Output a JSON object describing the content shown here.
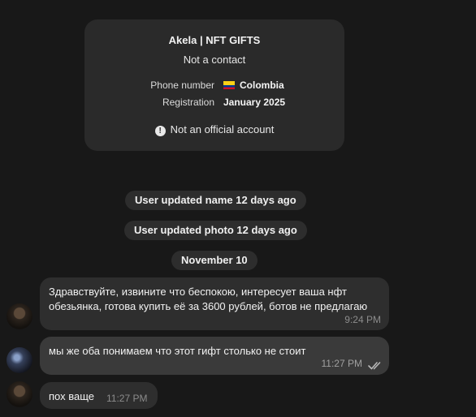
{
  "info_card": {
    "name": "Akela | NFT GIFTS",
    "subtitle": "Not a contact",
    "phone_label": "Phone number",
    "phone_value": "Colombia",
    "registration_label": "Registration",
    "registration_value": "January 2025",
    "official_notice": "Not an official account",
    "flag_icon": "colombia-flag"
  },
  "service_messages": {
    "name_updated": "User updated name 12 days ago",
    "photo_updated": "User updated photo 12 days ago",
    "date_separator": "November 10"
  },
  "messages": [
    {
      "text": "Здравствуйте, извините что беспокою, интересует ваша нфт обезьянка, готова купить её за 3600 рублей, ботов не предлагаю",
      "time": "9:24 PM",
      "outgoing": false
    },
    {
      "text": "мы же оба понимаем что этот гифт столько не стоит",
      "time": "11:27 PM",
      "outgoing": true,
      "status_icon": "double-check-icon"
    },
    {
      "text": "пох ваще",
      "time": "11:27 PM",
      "outgoing": false
    }
  ],
  "colors": {
    "background": "#181818",
    "card": "#2a2a2a",
    "bubble": "#2e2e2e",
    "selected_bubble": "#3a3a3a"
  }
}
